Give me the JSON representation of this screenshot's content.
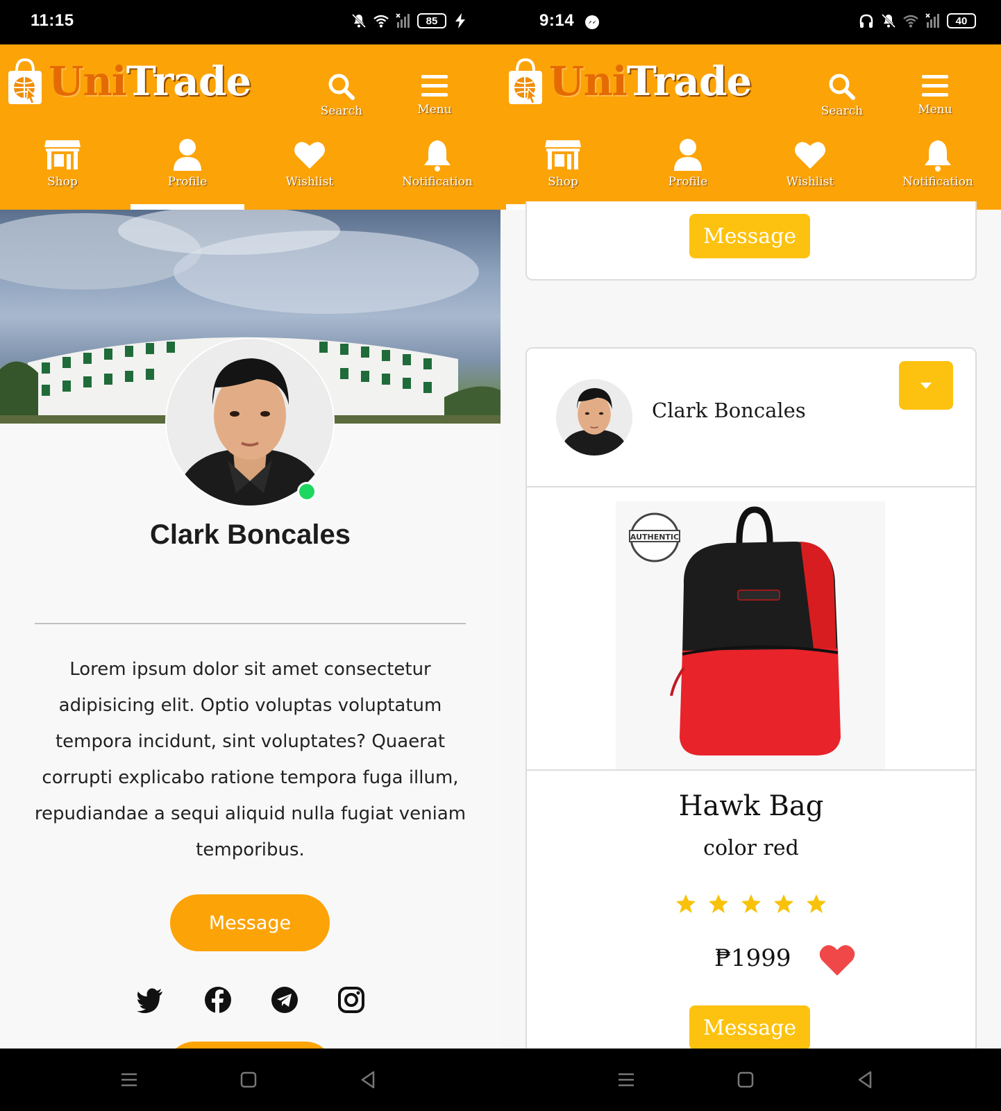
{
  "left": {
    "status": {
      "time": "11:15",
      "battery": "85"
    },
    "brand": {
      "part1": "Uni",
      "part2": "Trade"
    },
    "actions": {
      "search": "Search",
      "menu": "Menu"
    },
    "tabs": [
      "Shop",
      "Profile",
      "Wishlist",
      "Notification"
    ],
    "active_tab": "Profile",
    "profile": {
      "name": "Clark Boncales",
      "bio": "Lorem ipsum dolor sit amet consectetur adipisicing elit. Optio voluptas voluptatum tempora incidunt, sint voluptates? Quaerat corrupti explicabo ratione tempora fuga illum, repudiandae a sequi aliquid nulla fugiat veniam temporibus.",
      "message_button": "Message",
      "status": "online"
    },
    "socials": [
      "twitter-icon",
      "facebook-icon",
      "telegram-icon",
      "instagram-icon"
    ]
  },
  "right": {
    "status": {
      "time": "9:14",
      "battery": "40"
    },
    "brand": {
      "part1": "Uni",
      "part2": "Trade"
    },
    "actions": {
      "search": "Search",
      "menu": "Menu"
    },
    "tabs": [
      "Shop",
      "Profile",
      "Wishlist",
      "Notification"
    ],
    "active_tab": "Shop",
    "prev_card": {
      "message_button": "Message"
    },
    "post": {
      "seller": "Clark Boncales",
      "product_title": "Hawk Bag",
      "product_subtitle": "color red",
      "rating": 5,
      "rating_max": 5,
      "price": "₱1999",
      "message_button": "Message"
    }
  },
  "colors": {
    "brand_orange": "#fca307",
    "button_yellow": "#fdc20f",
    "online_green": "#1ed760",
    "heart_red": "#f04848"
  }
}
